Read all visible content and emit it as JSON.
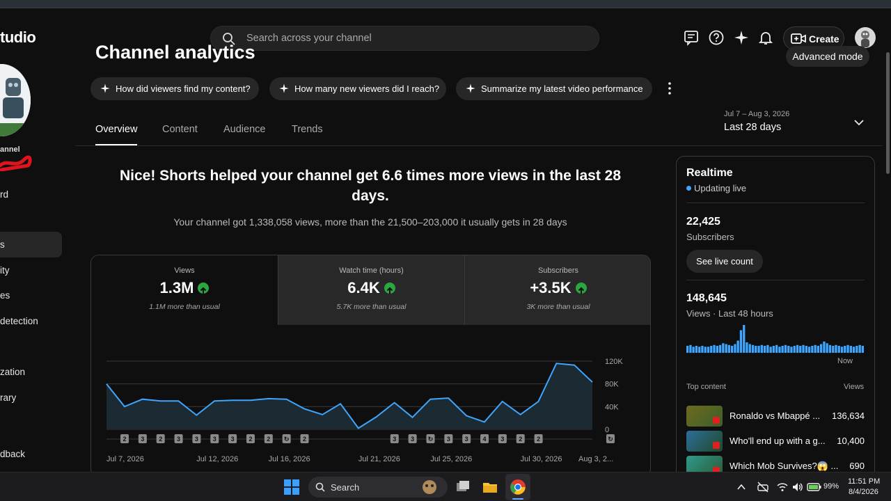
{
  "app": {
    "brand": "tudio"
  },
  "search": {
    "placeholder": "Search across your channel"
  },
  "toolbar": {
    "create_label": "Create",
    "icons": [
      "feedback-icon",
      "help-icon",
      "sparkle-icon",
      "bell-icon",
      "create-video-icon"
    ]
  },
  "sidebar": {
    "channel_name": "annel",
    "items": [
      "rd",
      "s",
      "ity",
      "es",
      "detection",
      "zation",
      "rary",
      "dback"
    ]
  },
  "page": {
    "title": "Channel analytics",
    "advanced_mode": "Advanced mode",
    "chips": [
      "How did viewers find my content?",
      "How many new viewers did I reach?",
      "Summarize my latest video performance"
    ],
    "tabs": [
      "Overview",
      "Content",
      "Audience",
      "Trends"
    ],
    "date_range": {
      "dates": "Jul 7 – Aug 3, 2026",
      "label": "Last 28 days"
    },
    "headline": "Nice! Shorts helped your channel get 6.6 times more views in the last 28 days.",
    "subline": "Your channel got 1,338,058 views, more than the 21,500–203,000 it usually gets in 28 days"
  },
  "metrics": [
    {
      "title": "Views",
      "value": "1.3M",
      "sub": "1.1M more than usual"
    },
    {
      "title": "Watch time (hours)",
      "value": "6.4K",
      "sub": "5.7K more than usual"
    },
    {
      "title": "Subscribers",
      "value": "+3.5K",
      "sub": "3K more than usual"
    }
  ],
  "chart_data": {
    "type": "area",
    "x_labels": [
      "Jul 7, 2026",
      "Jul 12, 2026",
      "Jul 16, 2026",
      "Jul 21, 2026",
      "Jul 25, 2026",
      "Jul 30, 2026",
      "Aug 3, 2..."
    ],
    "y_ticks": [
      "120K",
      "80K",
      "40K",
      "0"
    ],
    "ylim": [
      0,
      120000
    ],
    "values": [
      80000,
      40000,
      53000,
      50000,
      50000,
      25000,
      50000,
      51000,
      51000,
      54000,
      53000,
      36000,
      26000,
      45000,
      2000,
      22000,
      47000,
      21000,
      53000,
      55000,
      24000,
      13000,
      49000,
      26000,
      49000,
      116000,
      113000,
      83000
    ],
    "markers": [
      "2",
      "3",
      "2",
      "3",
      "3",
      "3",
      "3",
      "2",
      "2",
      "↻",
      "2",
      "",
      "",
      "",
      "",
      "3",
      "3",
      "↻",
      "3",
      "3",
      "4",
      "3",
      "2",
      "2",
      "",
      "",
      "",
      "↻"
    ],
    "color": "#3ea6ff",
    "grid": true
  },
  "realtime": {
    "title": "Realtime",
    "live": "Updating live",
    "subscribers": "22,425",
    "subscribers_label": "Subscribers",
    "see_live": "See live count",
    "views": "148,645",
    "views_label": "Views · Last 48 hours",
    "now": "Now",
    "spark": [
      8,
      9,
      7,
      8,
      7,
      8,
      7,
      7,
      8,
      9,
      8,
      9,
      11,
      10,
      9,
      8,
      10,
      14,
      26,
      32,
      12,
      10,
      9,
      8,
      8,
      9,
      8,
      9,
      7,
      8,
      9,
      7,
      8,
      9,
      8,
      7,
      8,
      9,
      8,
      9,
      8,
      7,
      8,
      9,
      8,
      10,
      13,
      11,
      9,
      8,
      9,
      8,
      7,
      8,
      9,
      8,
      7,
      8,
      9,
      8
    ],
    "top_content_label": "Top content",
    "views_col": "Views",
    "top": [
      {
        "title": "Ronaldo vs Mbappé ...",
        "views": "136,634"
      },
      {
        "title": "Who'll end up with a g...",
        "views": "10,400"
      },
      {
        "title": "Which Mob Survives?😱 ...",
        "views": "690"
      }
    ]
  },
  "taskbar": {
    "search": "Search",
    "battery": "99%",
    "time": "11:51 PM",
    "date": "8/4/2026"
  }
}
